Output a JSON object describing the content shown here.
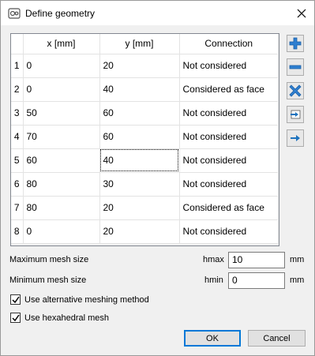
{
  "window": {
    "title": "Define geometry"
  },
  "table": {
    "headers": {
      "x": "x [mm]",
      "y": "y [mm]",
      "connection": "Connection"
    },
    "rows": [
      {
        "n": "1",
        "x": "0",
        "y": "20",
        "connection": "Not considered"
      },
      {
        "n": "2",
        "x": "0",
        "y": "40",
        "connection": "Considered as face"
      },
      {
        "n": "3",
        "x": "50",
        "y": "60",
        "connection": "Not considered"
      },
      {
        "n": "4",
        "x": "70",
        "y": "60",
        "connection": "Not considered"
      },
      {
        "n": "5",
        "x": "60",
        "y": "40",
        "connection": "Not considered"
      },
      {
        "n": "6",
        "x": "80",
        "y": "30",
        "connection": "Not considered"
      },
      {
        "n": "7",
        "x": "80",
        "y": "20",
        "connection": "Considered as face"
      },
      {
        "n": "8",
        "x": "0",
        "y": "20",
        "connection": "Not considered"
      }
    ]
  },
  "side_buttons": {
    "add_icon": "plus-icon",
    "remove_icon": "minus-icon",
    "delete_icon": "cross-icon",
    "insert_icon": "insert-icon",
    "append_icon": "arrow-right-icon"
  },
  "mesh": {
    "max_label": "Maximum mesh size",
    "max_symbol": "hmax",
    "max_value": "10",
    "max_unit": "mm",
    "min_label": "Minimum mesh size",
    "min_symbol": "hmin",
    "min_value": "0",
    "min_unit": "mm"
  },
  "options": {
    "alt_meshing": {
      "label": "Use alternative meshing method",
      "checked": true
    },
    "hexahedral": {
      "label": "Use hexahedral mesh",
      "checked": true
    }
  },
  "footer": {
    "ok": "OK",
    "cancel": "Cancel"
  },
  "colors": {
    "icon_blue": "#1e73be",
    "focus_blue": "#0078d7"
  }
}
